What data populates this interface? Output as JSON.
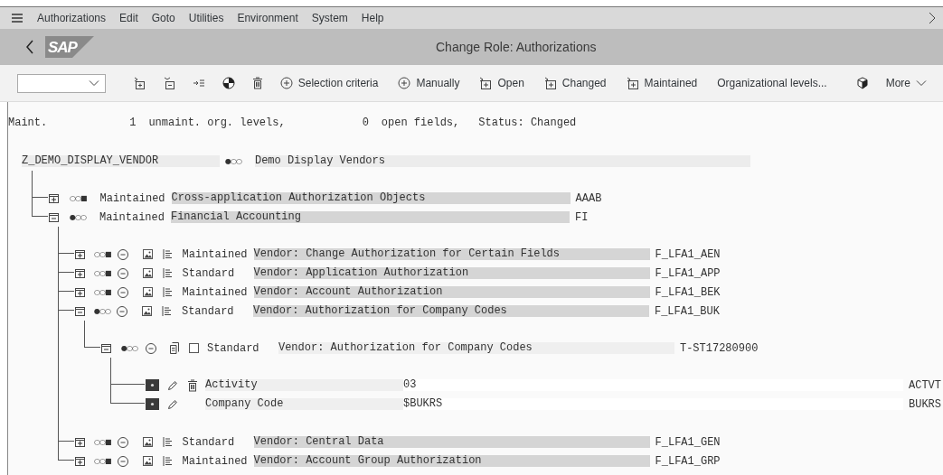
{
  "menu_bar": {
    "items": [
      "Authorizations",
      "Edit",
      "Goto",
      "Utilities",
      "Environment",
      "System",
      "Help"
    ]
  },
  "title_bar": {
    "logo": "SAP",
    "title": "Change Role: Authorizations"
  },
  "toolbar": [
    {
      "kind": "combo"
    },
    {
      "kind": "expand"
    },
    {
      "kind": "collapse"
    },
    {
      "kind": "jump"
    },
    {
      "kind": "pie"
    },
    {
      "kind": "trash"
    },
    {
      "kind": "add",
      "label": "Selection criteria"
    },
    {
      "kind": "add",
      "label": "Manually"
    },
    {
      "kind": "node",
      "label": "Open"
    },
    {
      "kind": "node",
      "label": "Changed"
    },
    {
      "kind": "node",
      "label": "Maintained"
    },
    {
      "kind": "plain",
      "label": "Organizational levels..."
    },
    {
      "kind": "package"
    },
    {
      "kind": "menu",
      "label": "More"
    }
  ],
  "status_line": [
    "Maint.",
    "1",
    "unmaint. org. levels,",
    "0",
    "open fields,",
    "Status: Changed"
  ],
  "tree": {
    "name": "Z_DEMO_DISPLAY_VENDOR",
    "indicator": "●○○",
    "description": "Demo Display Vendors",
    "children": [
      {
        "kind": "group",
        "expanded": false,
        "indicator": "○○■",
        "status": "Maintained",
        "description": "Cross-application Authorization Objects",
        "code": "AAAB"
      },
      {
        "kind": "group",
        "expanded": true,
        "indicator": "●○○",
        "status": "Maintained",
        "description": "Financial Accounting",
        "code": "FI",
        "children": [
          {
            "kind": "object",
            "expanded": false,
            "indicator": "○○■",
            "status": "Maintained",
            "description": "Vendor: Change Authorization for Certain Fields",
            "code": "F_LFA1_AEN"
          },
          {
            "kind": "object",
            "expanded": false,
            "indicator": "○○■",
            "status": "Standard",
            "description": "Vendor: Application Authorization",
            "code": "F_LFA1_APP"
          },
          {
            "kind": "object",
            "expanded": false,
            "indicator": "○○■",
            "status": "Maintained",
            "description": "Vendor: Account Authorization",
            "code": "F_LFA1_BEK"
          },
          {
            "kind": "object",
            "expanded": true,
            "indicator": "●○○",
            "status": "Standard",
            "description": "Vendor: Authorization for Company Codes",
            "code": "F_LFA1_BUK",
            "children": [
              {
                "kind": "authorization",
                "expanded": true,
                "indicator": "●○○",
                "checked": false,
                "status": "Standard",
                "description": "Vendor: Authorization for Company Codes",
                "code": "T-ST17280900",
                "children": [
                  {
                    "kind": "field",
                    "deletable": true,
                    "label": "Activity",
                    "value": "03",
                    "code": "ACTVT"
                  },
                  {
                    "kind": "field",
                    "deletable": false,
                    "label": "Company Code",
                    "value": "$BUKRS",
                    "code": "BUKRS"
                  }
                ]
              }
            ]
          },
          {
            "kind": "object",
            "expanded": false,
            "indicator": "○○■",
            "status": "Standard",
            "description": "Vendor: Central Data",
            "code": "F_LFA1_GEN"
          },
          {
            "kind": "object",
            "expanded": false,
            "indicator": "○○■",
            "status": "Maintained",
            "description": "Vendor: Account Group Authorization",
            "code": "F_LFA1_GRP"
          }
        ]
      }
    ]
  }
}
